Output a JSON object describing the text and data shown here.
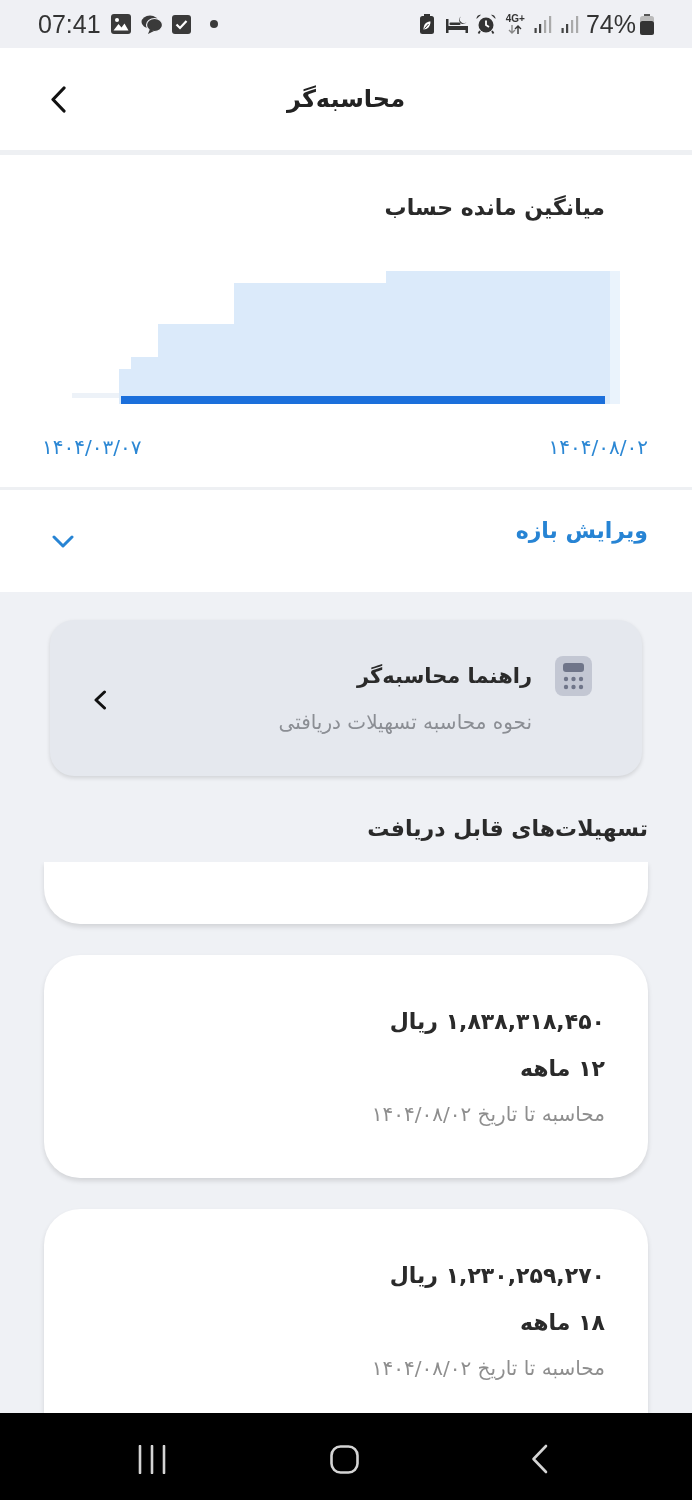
{
  "status_bar": {
    "time": "07:41",
    "network": "4G+",
    "battery": "74%"
  },
  "header": {
    "title": "محاسبه‌گر"
  },
  "balance_chart": {
    "title": "میانگین مانده حساب",
    "start_date": "۱۴۰۴/۰۳/۰۷",
    "end_date": "۱۴۰۴/۰۸/۰۲"
  },
  "range_editor": {
    "label": "ویرایش بازه",
    "expanded": false
  },
  "guide_card": {
    "title": "راهنما محاسبه‌گر",
    "subtitle": "نحوه محاسبه تسهیلات دریافتی"
  },
  "facilities": {
    "title": "تسهیلات‌های قابل دریافت",
    "items": [
      {
        "kind": "cut_off"
      },
      {
        "kind": "full",
        "amount": "۱,۸۳۸,۳۱۸,۴۵۰ ریال",
        "term": "۱۲ ماهه",
        "note": "محاسبه تا تاریخ ۱۴۰۴/۰۸/۰۲"
      },
      {
        "kind": "cut_bottom",
        "amount": "۱,۲۳۰,۲۵۹,۲۷۰ ریال",
        "term": "۱۸ ماهه",
        "note": "محاسبه تا تاریخ ۱۴۰۴/۰۸/۰۲"
      }
    ]
  }
}
